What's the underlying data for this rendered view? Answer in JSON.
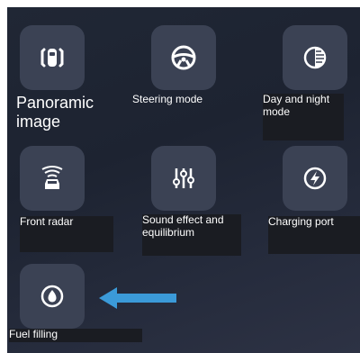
{
  "menu": {
    "items": [
      {
        "label": "Panoramic image",
        "icon": "car-top-view-icon"
      },
      {
        "label": "Steering mode",
        "icon": "steering-wheel-icon"
      },
      {
        "label": "Day and night mode",
        "icon": "day-night-icon"
      },
      {
        "label": "Front radar",
        "icon": "front-radar-icon"
      },
      {
        "label": "Sound effect and equilibrium",
        "icon": "equalizer-icon"
      },
      {
        "label": "Charging port",
        "icon": "lightning-icon"
      },
      {
        "label": "Fuel filling",
        "icon": "fuel-drop-icon"
      }
    ]
  },
  "annotation": {
    "arrow_color": "#3b9ad8",
    "arrow_target": "Fuel filling"
  },
  "colors": {
    "tile": "#3b4254",
    "icon": "#ffffff",
    "arrow": "#3b9ad8"
  }
}
